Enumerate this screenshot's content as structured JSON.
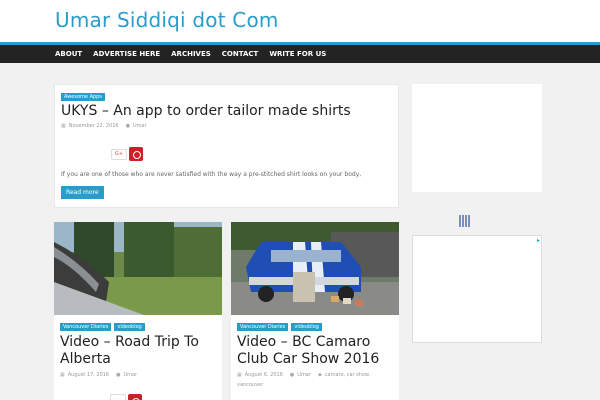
{
  "site": {
    "title": "Umar Siddiqi dot Com"
  },
  "nav": {
    "items": [
      "ABOUT",
      "ADVERTISE HERE",
      "ARCHIVES",
      "CONTACT",
      "WRITE FOR US"
    ]
  },
  "post1": {
    "category": "Awesome Apps",
    "title": "UKYS – An app to order tailor made shirts",
    "date": "November 22, 2016",
    "author": "Umar",
    "gplus": "G+",
    "excerpt": "If you are one of those who are never satisfied with the way a pre-stitched shirt looks on your body,",
    "read_more": "Read more"
  },
  "post2": {
    "tags": [
      "Vancouver Diaries",
      "videoblog"
    ],
    "title_line1": "Video – Road Trip To",
    "title_line2": "Alberta",
    "date": "August 17, 2016",
    "author": "Umar"
  },
  "post3": {
    "tags": [
      "Vancouver Diaries",
      "videoblog"
    ],
    "title_line1": "Video – BC Camaro",
    "title_line2": "Club Car Show 2016",
    "date": "August 6, 2016",
    "author": "Umar",
    "keywords": "camaro, car show,",
    "keywords2": "vancouver"
  },
  "colors": {
    "accent": "#289dcc",
    "nav_bg": "#232323",
    "pinterest": "#cb2027"
  },
  "icons": [
    "calendar-icon",
    "user-icon",
    "tag-icon",
    "pinterest-icon",
    "google-plus-icon",
    "ad-choices-icon"
  ]
}
